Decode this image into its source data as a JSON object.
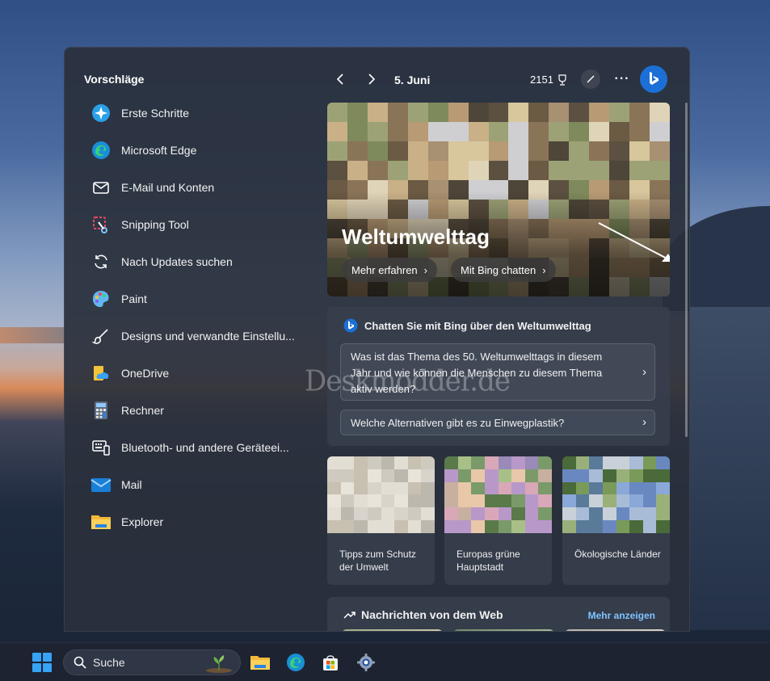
{
  "sidebar": {
    "title": "Vorschläge",
    "items": [
      {
        "label": "Erste Schritte",
        "icon": "get-started-icon"
      },
      {
        "label": "Microsoft Edge",
        "icon": "edge-icon"
      },
      {
        "label": "E-Mail und Konten",
        "icon": "mail-outline-icon"
      },
      {
        "label": "Snipping Tool",
        "icon": "snipping-tool-icon"
      },
      {
        "label": "Nach Updates suchen",
        "icon": "update-icon"
      },
      {
        "label": "Paint",
        "icon": "paint-icon"
      },
      {
        "label": "Designs und verwandte Einstellu...",
        "icon": "brush-icon"
      },
      {
        "label": "OneDrive",
        "icon": "onedrive-icon"
      },
      {
        "label": "Rechner",
        "icon": "calculator-icon"
      },
      {
        "label": "Bluetooth- und andere Geräteei...",
        "icon": "bluetooth-devices-icon"
      },
      {
        "label": "Mail",
        "icon": "mail-app-icon"
      },
      {
        "label": "Explorer",
        "icon": "explorer-icon"
      }
    ]
  },
  "header": {
    "date": "5. Juni",
    "points": "2151"
  },
  "hero": {
    "title": "Weltumwelttag",
    "button_learn": "Mehr erfahren",
    "button_chat": "Mit Bing chatten"
  },
  "chat": {
    "title": "Chatten Sie mit Bing über den Weltumwelttag",
    "question1": "Was ist das Thema des 50. Weltumwelttags in diesem Jahr und wie können die Menschen zu diesem Thema aktiv werden?",
    "question2": "Welche Alternativen gibt es zu Einwegplastik?"
  },
  "tiles": [
    {
      "text": "Tipps zum Schutz der Umwelt"
    },
    {
      "text": "Europas grüne Hauptstadt"
    },
    {
      "text": "Ökologische Länder"
    }
  ],
  "news": {
    "title": "Nachrichten von dem Web",
    "more": "Mehr anzeigen"
  },
  "watermark": "Deskmodder.de",
  "taskbar": {
    "search_label": "Suche"
  },
  "colors": {
    "accent": "#1c6fd6",
    "link": "#7fc4ff",
    "panel": "#2a303c"
  }
}
